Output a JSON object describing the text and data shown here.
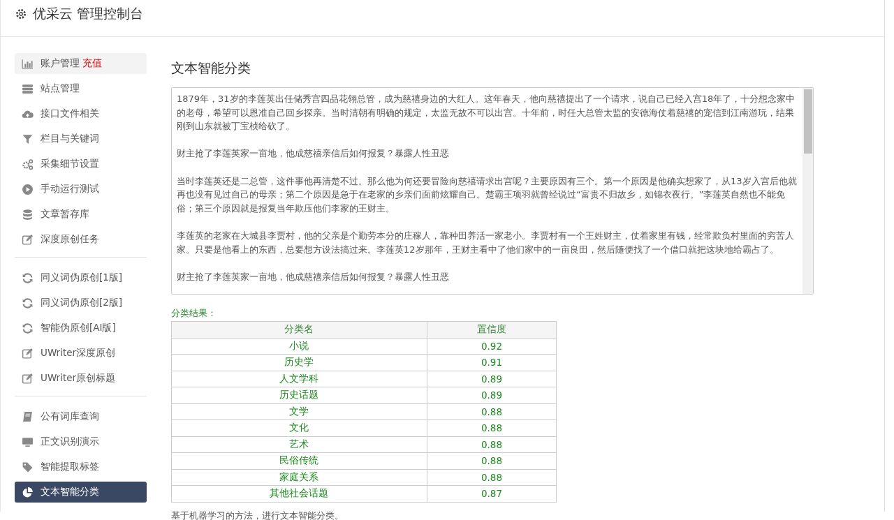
{
  "header": {
    "title": "优采云 管理控制台"
  },
  "sidebar": {
    "groups": [
      {
        "items": [
          {
            "label": "账户管理",
            "badge": "充值",
            "hovered": true,
            "selected": false
          },
          {
            "label": "站点管理",
            "hovered": false,
            "selected": false
          },
          {
            "label": "接口文件相关",
            "hovered": false,
            "selected": false
          },
          {
            "label": "栏目与关键词",
            "hovered": false,
            "selected": false
          },
          {
            "label": "采集细节设置",
            "hovered": false,
            "selected": false
          },
          {
            "label": "手动运行测试",
            "hovered": false,
            "selected": false
          },
          {
            "label": "文章暂存库",
            "hovered": false,
            "selected": false
          },
          {
            "label": "深度原创任务",
            "hovered": false,
            "selected": false
          }
        ]
      },
      {
        "items": [
          {
            "label": "同义词伪原创[1版]",
            "hovered": false,
            "selected": false
          },
          {
            "label": "同义词伪原创[2版]",
            "hovered": false,
            "selected": false
          },
          {
            "label": "智能伪原创[AI版]",
            "hovered": false,
            "selected": false
          },
          {
            "label": "UWriter深度原创",
            "hovered": false,
            "selected": false
          },
          {
            "label": "UWriter原创标题",
            "hovered": false,
            "selected": false
          }
        ]
      },
      {
        "items": [
          {
            "label": "公有词库查询",
            "hovered": false,
            "selected": false
          },
          {
            "label": "正文识别演示",
            "hovered": false,
            "selected": false
          },
          {
            "label": "智能提取标签",
            "hovered": false,
            "selected": false
          },
          {
            "label": "文本智能分类",
            "hovered": false,
            "selected": true
          }
        ]
      }
    ]
  },
  "main": {
    "heading": "文本智能分类",
    "input_text": {
      "paragraphs": [
        "1879年，31岁的李莲英出任储秀宫四品花翎总管，成为慈禧身边的大红人。这年春天，他向慈禧提出了一个请求，说自己已经入宫18年了，十分想念家中的老母，希望可以恩准自己回乡探亲。当时清朝有明确的规定，太监无故不可以出宫。十年前，时任大总管太监的安德海仗着慈禧的宠信到江南游玩，结果刚到山东就被丁宝桢给砍了。",
        "财主抢了李莲英家一亩地，他成慈禧亲信后如何报复？暴露人性丑恶",
        "当时李莲英还是二总管，这件事他再清楚不过。那么他为何还要冒险向慈禧请求出宫呢？主要原因有三个。第一个原因是他确实想家了，从13岁入宫后他就再也没有见过自己的母亲；第二个原因是急于在老家的乡亲们面前炫耀自己。楚霸王项羽就曾经说过“富贵不归故乡，如锦衣夜行。”李莲英自然也不能免俗；第三个原因就是报复当年欺压他们李家的王财主。",
        "李莲英的老家在大城县李贾村，他的父亲是个勤劳本分的庄稼人，靠种田养活一家老小。李贾村有一个王姓财主，仗着家里有钱，经常欺负村里面的穷苦人家。只要是他看上的东西，总要想方设法搞过来。李莲英12岁那年，王财主看中了他们家中的一亩良田，然后随便找了一个借口就把这块地给霸占了。",
        "财主抢了李莲英家一亩地，他成慈禧亲信后如何报复？暴露人性丑恶"
      ]
    },
    "result_label": "分类结果：",
    "table": {
      "columns": [
        "分类名",
        "置信度"
      ],
      "rows": [
        [
          "小说",
          "0.92"
        ],
        [
          "历史学",
          "0.91"
        ],
        [
          "人文学科",
          "0.89"
        ],
        [
          "历史话题",
          "0.89"
        ],
        [
          "文学",
          "0.88"
        ],
        [
          "文化",
          "0.88"
        ],
        [
          "艺术",
          "0.88"
        ],
        [
          "民俗传统",
          "0.88"
        ],
        [
          "家庭关系",
          "0.88"
        ],
        [
          "其他社会话题",
          "0.87"
        ]
      ]
    },
    "footnote": "基于机器学习的方法，进行文本智能分类。"
  }
}
